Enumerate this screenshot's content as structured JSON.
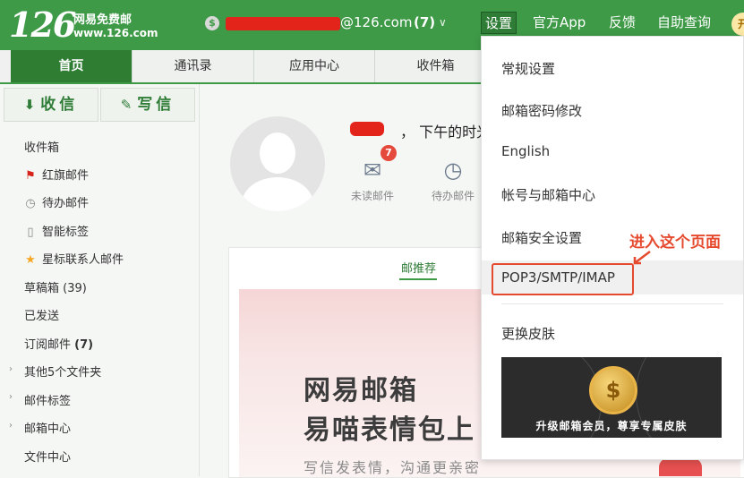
{
  "header": {
    "logo_number": "126",
    "logo_name": "网易免费邮",
    "logo_url": "www.126.com",
    "account_icon": "$",
    "account_domain": "@126.com",
    "account_count": "(7)",
    "account_chevron": "∨",
    "nav": [
      "设置",
      "官方App",
      "反馈",
      "自助查询"
    ],
    "avatar_mini": "开"
  },
  "tabs": [
    "首页",
    "通讯录",
    "应用中心",
    "收件箱"
  ],
  "sidebar": {
    "receive_label": "收信",
    "write_label": "写信",
    "items": [
      {
        "label": "收件箱"
      },
      {
        "label": "红旗邮件",
        "icon": "flag-icon"
      },
      {
        "label": "待办邮件",
        "icon": "clock-icon"
      },
      {
        "label": "智能标签",
        "icon": "bookmark-icon"
      },
      {
        "label": "星标联系人邮件",
        "icon": "star-icon"
      },
      {
        "label": "草稿箱 (39)"
      },
      {
        "label": "已发送"
      },
      {
        "label": "订阅邮件",
        "count": "(7)"
      },
      {
        "label": "其他5个文件夹",
        "expandable": true
      },
      {
        "label": "邮件标签",
        "expandable": true
      },
      {
        "label": "邮箱中心",
        "expandable": true
      },
      {
        "label": "文件中心"
      }
    ]
  },
  "main": {
    "greeting": "下午的时光",
    "unread_label": "未读邮件",
    "unread_count": "7",
    "todo_label": "待办邮件",
    "recommend_tab": "邮推荐",
    "banner_title_1": "网易邮箱",
    "banner_title_2": "易喵表情包上",
    "banner_sub": "写信发表情，沟通更亲密"
  },
  "dropdown": {
    "items": [
      "常规设置",
      "邮箱密码修改",
      "English",
      "帐号与邮箱中心",
      "邮箱安全设置",
      "POP3/SMTP/IMAP",
      "更换皮肤"
    ],
    "skin_caption": "升级邮箱会员，尊享专属皮肤"
  },
  "annotation": {
    "text": "进入这个页面",
    "color": "#e64a2e"
  },
  "colors": {
    "brand_green": "#3e9a47",
    "tab_active": "#2e7d32",
    "redaction": "#e3241b"
  }
}
